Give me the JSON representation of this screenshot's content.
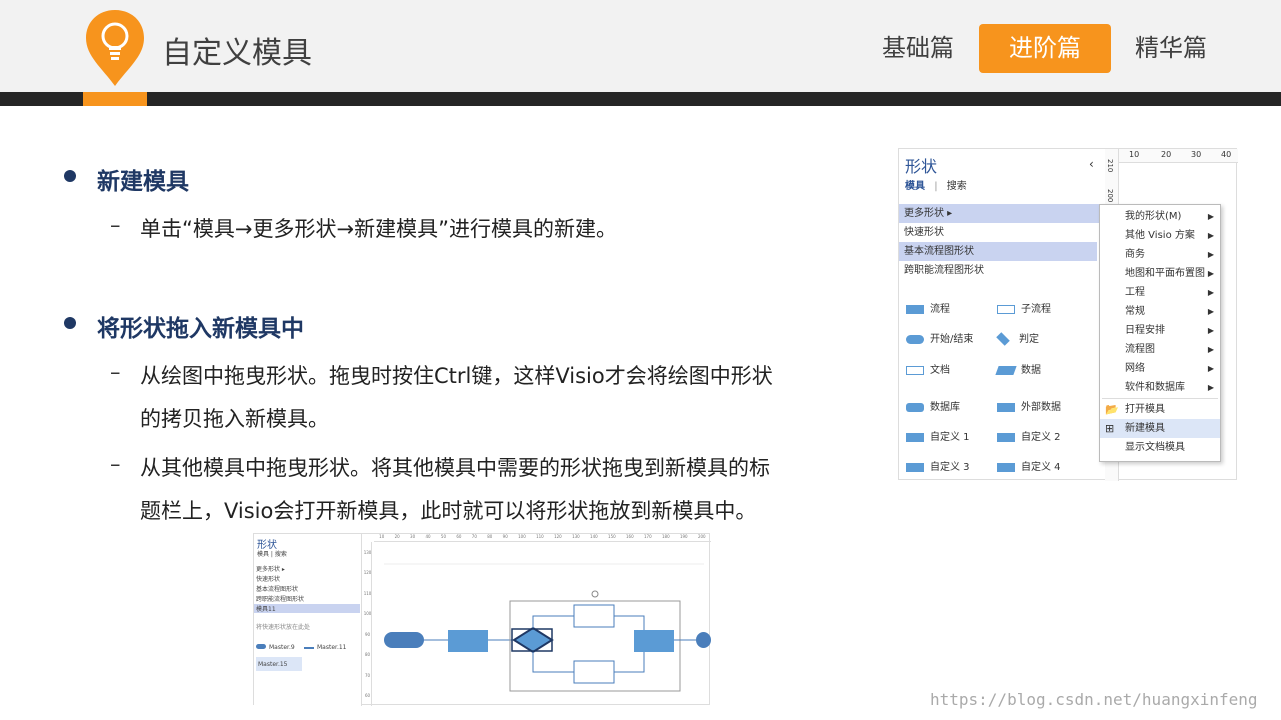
{
  "header": {
    "title": "自定义模具",
    "tabs": [
      {
        "label": "基础篇",
        "active": false
      },
      {
        "label": "进阶篇",
        "active": true
      },
      {
        "label": "精华篇",
        "active": false
      }
    ],
    "accent": "#f7941d"
  },
  "content": {
    "sections": [
      {
        "heading": "新建模具",
        "items": [
          "单击“模具→更多形状→新建模具”进行模具的新建。"
        ]
      },
      {
        "heading": "将形状拖入新模具中",
        "items": [
          [
            "从绘图中拖曳形状。拖曳时按住Ctrl键，这样Visio才会将绘图中形状",
            "的拷贝拖入新模具。"
          ],
          [
            "从其他模具中拖曳形状。将其他模具中需要的形状拖曳到新模具的标",
            "题栏上，Visio会打开新模具，此时就可以将形状拖放到新模具中。"
          ]
        ],
        "dash": "–"
      }
    ]
  },
  "screenshot": {
    "title": "形状",
    "collapse": "‹",
    "tabs": [
      "模具",
      "搜索"
    ],
    "ruler_ticks": [
      "10",
      "20",
      "30",
      "40"
    ],
    "vruler_ticks": [
      "210",
      "200"
    ],
    "stencils": [
      "更多形状 ▸",
      "快速形状",
      "基本流程图形状",
      "跨职能流程图形状"
    ],
    "shapes": [
      [
        "流程",
        "子流程"
      ],
      [
        "开始/结束",
        "判定"
      ],
      [
        "文档",
        "数据"
      ],
      [
        "数据库",
        "外部数据"
      ],
      [
        "自定义 1",
        "自定义 2"
      ],
      [
        "自定义 3",
        "自定义 4"
      ]
    ],
    "menu": [
      "我的形状(M)",
      "其他 Visio 方案",
      "商务",
      "地图和平面布置图",
      "工程",
      "常规",
      "日程安排",
      "流程图",
      "网络",
      "软件和数据库",
      "打开模具",
      "新建模具",
      "显示文档模具"
    ]
  },
  "screenshot2": {
    "title": "形状",
    "tabs": [
      "模具",
      "搜索"
    ],
    "stencils": [
      "更多形状 ▸",
      "快速形状",
      "基本流程图形状",
      "跨职能流程图形状",
      "模具11"
    ],
    "hint": "将快速形状放在此处",
    "masters": [
      "Master.9",
      "Master.11",
      "Master.15"
    ],
    "ruler_ticks": [
      "10",
      "20",
      "30",
      "40",
      "50",
      "60",
      "70",
      "80",
      "90",
      "100",
      "110",
      "120",
      "130",
      "140",
      "150",
      "160",
      "170",
      "180",
      "190",
      "200"
    ],
    "vruler_ticks": [
      "130",
      "120",
      "110",
      "100",
      "90",
      "80",
      "70",
      "60"
    ]
  },
  "watermark": "https://blog.csdn.net/huangxinfeng"
}
